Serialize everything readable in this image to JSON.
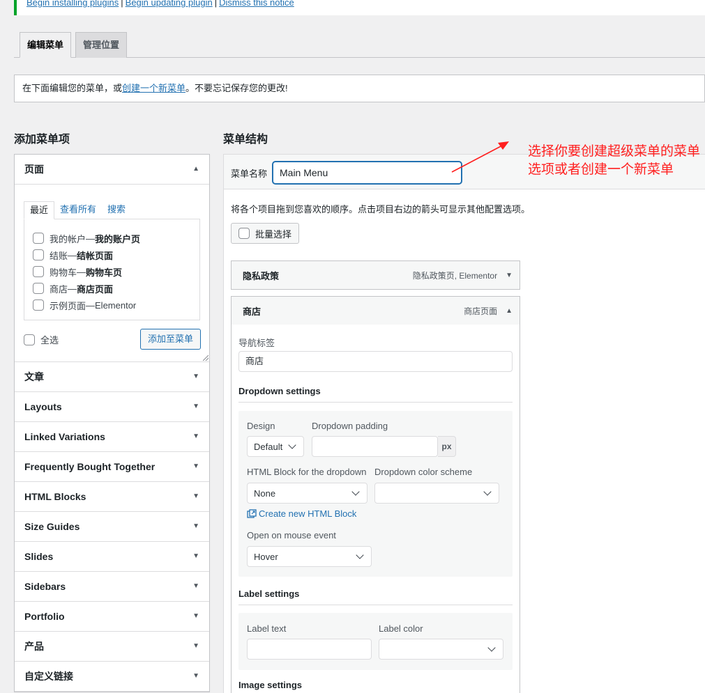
{
  "notice": {
    "links": [
      "Begin installing plugins",
      "Begin updating plugin",
      "Dismiss this notice"
    ]
  },
  "tabs": [
    "编辑菜单",
    "管理位置"
  ],
  "manage": {
    "prefix": "在下面编辑您的菜单，或",
    "link": "创建一个新菜单",
    "suffix": "。不要忘记保存您的更改!"
  },
  "left": {
    "heading": "添加菜单项",
    "pages": {
      "title": "页面",
      "subtabs": [
        "最近",
        "查看所有",
        "搜索"
      ],
      "items": [
        {
          "name": "我的帐户",
          "sep": " — ",
          "bold": "我的账户页"
        },
        {
          "name": "结账",
          "sep": " — ",
          "bold": "结帐页面"
        },
        {
          "name": "购物车",
          "sep": " — ",
          "bold": "购物车页"
        },
        {
          "name": "商店",
          "sep": " — ",
          "bold": "商店页面"
        },
        {
          "name": "示例页面",
          "sep": " — ",
          "bold": "Elementor"
        }
      ],
      "select_all": "全选",
      "add_button": "添加至菜单"
    },
    "sections": [
      "文章",
      "Layouts",
      "Linked Variations",
      "Frequently Bought Together",
      "HTML Blocks",
      "Size Guides",
      "Slides",
      "Sidebars",
      "Portfolio",
      "产品",
      "自定义链接"
    ]
  },
  "right": {
    "heading": "菜单结构",
    "name_label": "菜单名称",
    "name_value": "Main Menu",
    "hint": "将各个项目拖到您喜欢的顺序。点击项目右边的箭头可显示其他配置选项。",
    "bulk": "批量选择",
    "item1": {
      "title": "隐私政策",
      "meta": "隐私政策页, Elementor"
    },
    "item2": {
      "title": "商店",
      "meta": "商店页面"
    },
    "nav_label": "导航标签",
    "nav_value": "商店",
    "dropdown": {
      "title": "Dropdown settings",
      "design_label": "Design",
      "design_value": "Default",
      "padding_label": "Dropdown padding",
      "padding_unit": "px",
      "html_block_label": "HTML Block for the dropdown",
      "html_block_value": "None",
      "color_scheme_label": "Dropdown color scheme",
      "create_link": "Create new HTML Block",
      "mouse_label": "Open on mouse event",
      "mouse_value": "Hover"
    },
    "label_settings": {
      "title": "Label settings",
      "text_label": "Label text",
      "color_label": "Label color"
    },
    "image_settings": {
      "title": "Image settings"
    }
  },
  "annotation": "选择你要创建超级菜单的菜单选项或者创建一个新菜单",
  "colors": {
    "annotation": "#ff1f1f",
    "link": "#2271b1",
    "notice_border": "#00a32a"
  }
}
